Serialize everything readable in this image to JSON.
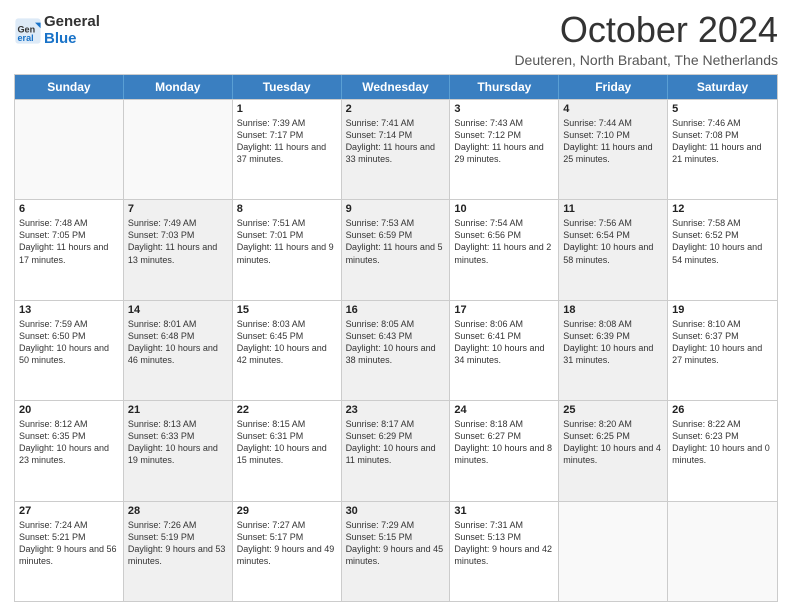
{
  "header": {
    "logo_line1": "General",
    "logo_line2": "Blue",
    "month": "October 2024",
    "location": "Deuteren, North Brabant, The Netherlands"
  },
  "weekdays": [
    "Sunday",
    "Monday",
    "Tuesday",
    "Wednesday",
    "Thursday",
    "Friday",
    "Saturday"
  ],
  "rows": [
    [
      {
        "day": "",
        "sunrise": "",
        "sunset": "",
        "daylight": "",
        "shaded": false,
        "empty": true
      },
      {
        "day": "",
        "sunrise": "",
        "sunset": "",
        "daylight": "",
        "shaded": false,
        "empty": true
      },
      {
        "day": "1",
        "sunrise": "Sunrise: 7:39 AM",
        "sunset": "Sunset: 7:17 PM",
        "daylight": "Daylight: 11 hours and 37 minutes.",
        "shaded": false,
        "empty": false
      },
      {
        "day": "2",
        "sunrise": "Sunrise: 7:41 AM",
        "sunset": "Sunset: 7:14 PM",
        "daylight": "Daylight: 11 hours and 33 minutes.",
        "shaded": true,
        "empty": false
      },
      {
        "day": "3",
        "sunrise": "Sunrise: 7:43 AM",
        "sunset": "Sunset: 7:12 PM",
        "daylight": "Daylight: 11 hours and 29 minutes.",
        "shaded": false,
        "empty": false
      },
      {
        "day": "4",
        "sunrise": "Sunrise: 7:44 AM",
        "sunset": "Sunset: 7:10 PM",
        "daylight": "Daylight: 11 hours and 25 minutes.",
        "shaded": true,
        "empty": false
      },
      {
        "day": "5",
        "sunrise": "Sunrise: 7:46 AM",
        "sunset": "Sunset: 7:08 PM",
        "daylight": "Daylight: 11 hours and 21 minutes.",
        "shaded": false,
        "empty": false
      }
    ],
    [
      {
        "day": "6",
        "sunrise": "Sunrise: 7:48 AM",
        "sunset": "Sunset: 7:05 PM",
        "daylight": "Daylight: 11 hours and 17 minutes.",
        "shaded": false,
        "empty": false
      },
      {
        "day": "7",
        "sunrise": "Sunrise: 7:49 AM",
        "sunset": "Sunset: 7:03 PM",
        "daylight": "Daylight: 11 hours and 13 minutes.",
        "shaded": true,
        "empty": false
      },
      {
        "day": "8",
        "sunrise": "Sunrise: 7:51 AM",
        "sunset": "Sunset: 7:01 PM",
        "daylight": "Daylight: 11 hours and 9 minutes.",
        "shaded": false,
        "empty": false
      },
      {
        "day": "9",
        "sunrise": "Sunrise: 7:53 AM",
        "sunset": "Sunset: 6:59 PM",
        "daylight": "Daylight: 11 hours and 5 minutes.",
        "shaded": true,
        "empty": false
      },
      {
        "day": "10",
        "sunrise": "Sunrise: 7:54 AM",
        "sunset": "Sunset: 6:56 PM",
        "daylight": "Daylight: 11 hours and 2 minutes.",
        "shaded": false,
        "empty": false
      },
      {
        "day": "11",
        "sunrise": "Sunrise: 7:56 AM",
        "sunset": "Sunset: 6:54 PM",
        "daylight": "Daylight: 10 hours and 58 minutes.",
        "shaded": true,
        "empty": false
      },
      {
        "day": "12",
        "sunrise": "Sunrise: 7:58 AM",
        "sunset": "Sunset: 6:52 PM",
        "daylight": "Daylight: 10 hours and 54 minutes.",
        "shaded": false,
        "empty": false
      }
    ],
    [
      {
        "day": "13",
        "sunrise": "Sunrise: 7:59 AM",
        "sunset": "Sunset: 6:50 PM",
        "daylight": "Daylight: 10 hours and 50 minutes.",
        "shaded": false,
        "empty": false
      },
      {
        "day": "14",
        "sunrise": "Sunrise: 8:01 AM",
        "sunset": "Sunset: 6:48 PM",
        "daylight": "Daylight: 10 hours and 46 minutes.",
        "shaded": true,
        "empty": false
      },
      {
        "day": "15",
        "sunrise": "Sunrise: 8:03 AM",
        "sunset": "Sunset: 6:45 PM",
        "daylight": "Daylight: 10 hours and 42 minutes.",
        "shaded": false,
        "empty": false
      },
      {
        "day": "16",
        "sunrise": "Sunrise: 8:05 AM",
        "sunset": "Sunset: 6:43 PM",
        "daylight": "Daylight: 10 hours and 38 minutes.",
        "shaded": true,
        "empty": false
      },
      {
        "day": "17",
        "sunrise": "Sunrise: 8:06 AM",
        "sunset": "Sunset: 6:41 PM",
        "daylight": "Daylight: 10 hours and 34 minutes.",
        "shaded": false,
        "empty": false
      },
      {
        "day": "18",
        "sunrise": "Sunrise: 8:08 AM",
        "sunset": "Sunset: 6:39 PM",
        "daylight": "Daylight: 10 hours and 31 minutes.",
        "shaded": true,
        "empty": false
      },
      {
        "day": "19",
        "sunrise": "Sunrise: 8:10 AM",
        "sunset": "Sunset: 6:37 PM",
        "daylight": "Daylight: 10 hours and 27 minutes.",
        "shaded": false,
        "empty": false
      }
    ],
    [
      {
        "day": "20",
        "sunrise": "Sunrise: 8:12 AM",
        "sunset": "Sunset: 6:35 PM",
        "daylight": "Daylight: 10 hours and 23 minutes.",
        "shaded": false,
        "empty": false
      },
      {
        "day": "21",
        "sunrise": "Sunrise: 8:13 AM",
        "sunset": "Sunset: 6:33 PM",
        "daylight": "Daylight: 10 hours and 19 minutes.",
        "shaded": true,
        "empty": false
      },
      {
        "day": "22",
        "sunrise": "Sunrise: 8:15 AM",
        "sunset": "Sunset: 6:31 PM",
        "daylight": "Daylight: 10 hours and 15 minutes.",
        "shaded": false,
        "empty": false
      },
      {
        "day": "23",
        "sunrise": "Sunrise: 8:17 AM",
        "sunset": "Sunset: 6:29 PM",
        "daylight": "Daylight: 10 hours and 11 minutes.",
        "shaded": true,
        "empty": false
      },
      {
        "day": "24",
        "sunrise": "Sunrise: 8:18 AM",
        "sunset": "Sunset: 6:27 PM",
        "daylight": "Daylight: 10 hours and 8 minutes.",
        "shaded": false,
        "empty": false
      },
      {
        "day": "25",
        "sunrise": "Sunrise: 8:20 AM",
        "sunset": "Sunset: 6:25 PM",
        "daylight": "Daylight: 10 hours and 4 minutes.",
        "shaded": true,
        "empty": false
      },
      {
        "day": "26",
        "sunrise": "Sunrise: 8:22 AM",
        "sunset": "Sunset: 6:23 PM",
        "daylight": "Daylight: 10 hours and 0 minutes.",
        "shaded": false,
        "empty": false
      }
    ],
    [
      {
        "day": "27",
        "sunrise": "Sunrise: 7:24 AM",
        "sunset": "Sunset: 5:21 PM",
        "daylight": "Daylight: 9 hours and 56 minutes.",
        "shaded": false,
        "empty": false
      },
      {
        "day": "28",
        "sunrise": "Sunrise: 7:26 AM",
        "sunset": "Sunset: 5:19 PM",
        "daylight": "Daylight: 9 hours and 53 minutes.",
        "shaded": true,
        "empty": false
      },
      {
        "day": "29",
        "sunrise": "Sunrise: 7:27 AM",
        "sunset": "Sunset: 5:17 PM",
        "daylight": "Daylight: 9 hours and 49 minutes.",
        "shaded": false,
        "empty": false
      },
      {
        "day": "30",
        "sunrise": "Sunrise: 7:29 AM",
        "sunset": "Sunset: 5:15 PM",
        "daylight": "Daylight: 9 hours and 45 minutes.",
        "shaded": true,
        "empty": false
      },
      {
        "day": "31",
        "sunrise": "Sunrise: 7:31 AM",
        "sunset": "Sunset: 5:13 PM",
        "daylight": "Daylight: 9 hours and 42 minutes.",
        "shaded": false,
        "empty": false
      },
      {
        "day": "",
        "sunrise": "",
        "sunset": "",
        "daylight": "",
        "shaded": false,
        "empty": true
      },
      {
        "day": "",
        "sunrise": "",
        "sunset": "",
        "daylight": "",
        "shaded": false,
        "empty": true
      }
    ]
  ]
}
